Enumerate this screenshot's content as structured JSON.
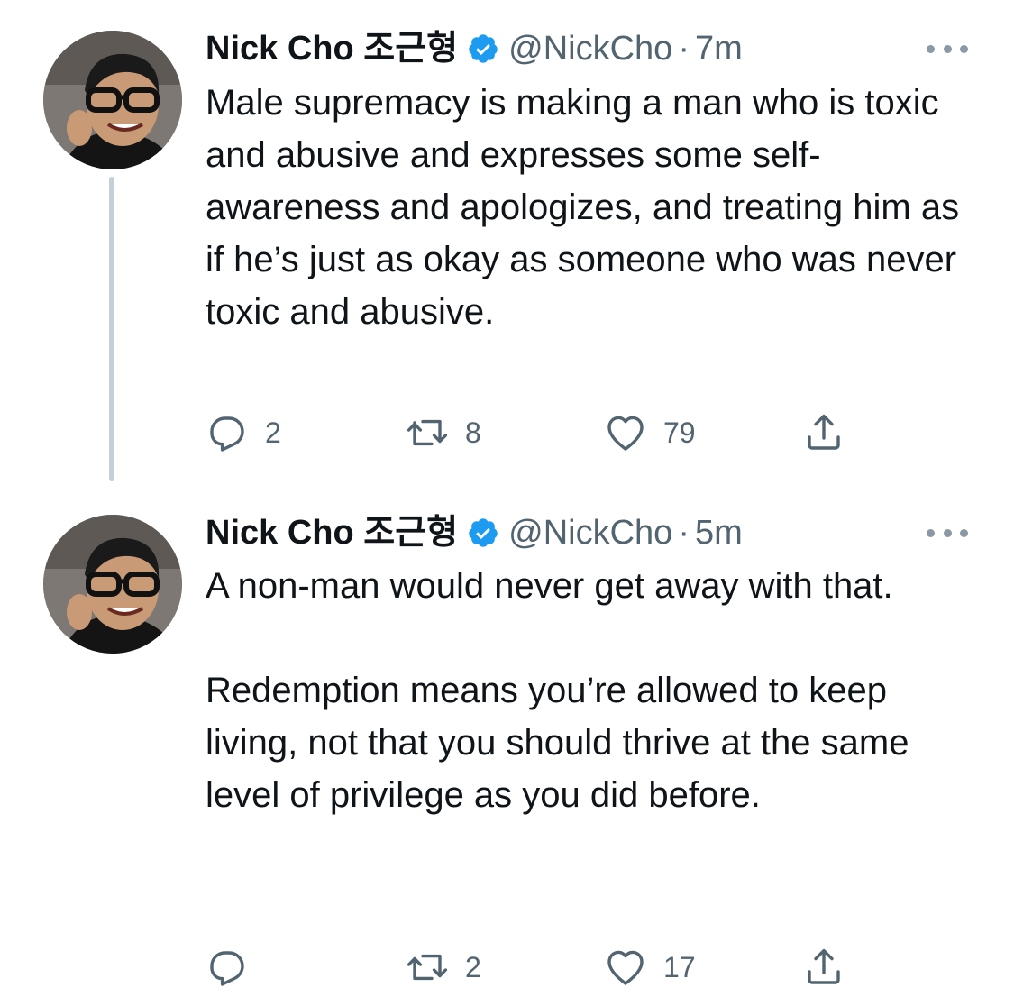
{
  "tweets": [
    {
      "author_name": "Nick Cho 조근형",
      "handle": "@NickCho",
      "separator": "·",
      "time": "7m",
      "paragraphs": [
        "Male supremacy is making a man who is toxic and abusive and expresses some self-awareness and apologizes, and treating him as if he’s just as okay as someone who was never toxic and abusive."
      ],
      "reply_count": "2",
      "retweet_count": "8",
      "like_count": "79"
    },
    {
      "author_name": "Nick Cho 조근형",
      "handle": "@NickCho",
      "separator": "·",
      "time": "5m",
      "paragraphs": [
        "A non-man would never get away with that.",
        "Redemption means you’re allowed to keep living, not that you should thrive at the same level of privilege as you did before."
      ],
      "reply_count": "",
      "retweet_count": "2",
      "like_count": "17"
    }
  ],
  "icons": {
    "verified": "verified-badge-icon",
    "more": "more-options-icon",
    "reply": "reply-icon",
    "retweet": "retweet-icon",
    "like": "heart-icon",
    "share": "share-icon"
  },
  "colors": {
    "verified_blue": "#1d9bf0",
    "secondary_text": "#536471",
    "thread_line": "#c4cfd6"
  }
}
